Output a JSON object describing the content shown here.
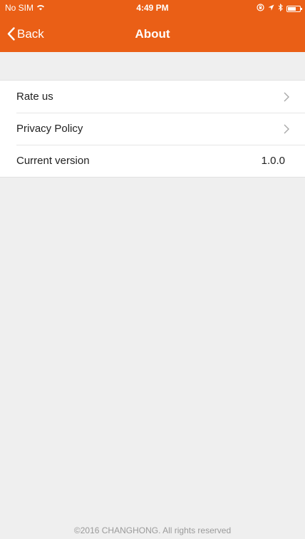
{
  "status_bar": {
    "carrier": "No SIM",
    "time": "4:49 PM"
  },
  "nav": {
    "back_label": "Back",
    "title": "About"
  },
  "list": {
    "items": [
      {
        "label": "Rate us"
      },
      {
        "label": "Privacy Policy"
      },
      {
        "label": "Current version",
        "value": "1.0.0"
      }
    ]
  },
  "footer": {
    "text": "©2016 CHANGHONG. All rights reserved"
  },
  "colors": {
    "header": "#ea5f16",
    "background": "#efefef"
  },
  "icons": [
    "wifi-icon",
    "lock-rotation-icon",
    "location-icon",
    "bluetooth-icon",
    "battery-icon",
    "back-chevron-icon",
    "chevron-right-icon"
  ]
}
